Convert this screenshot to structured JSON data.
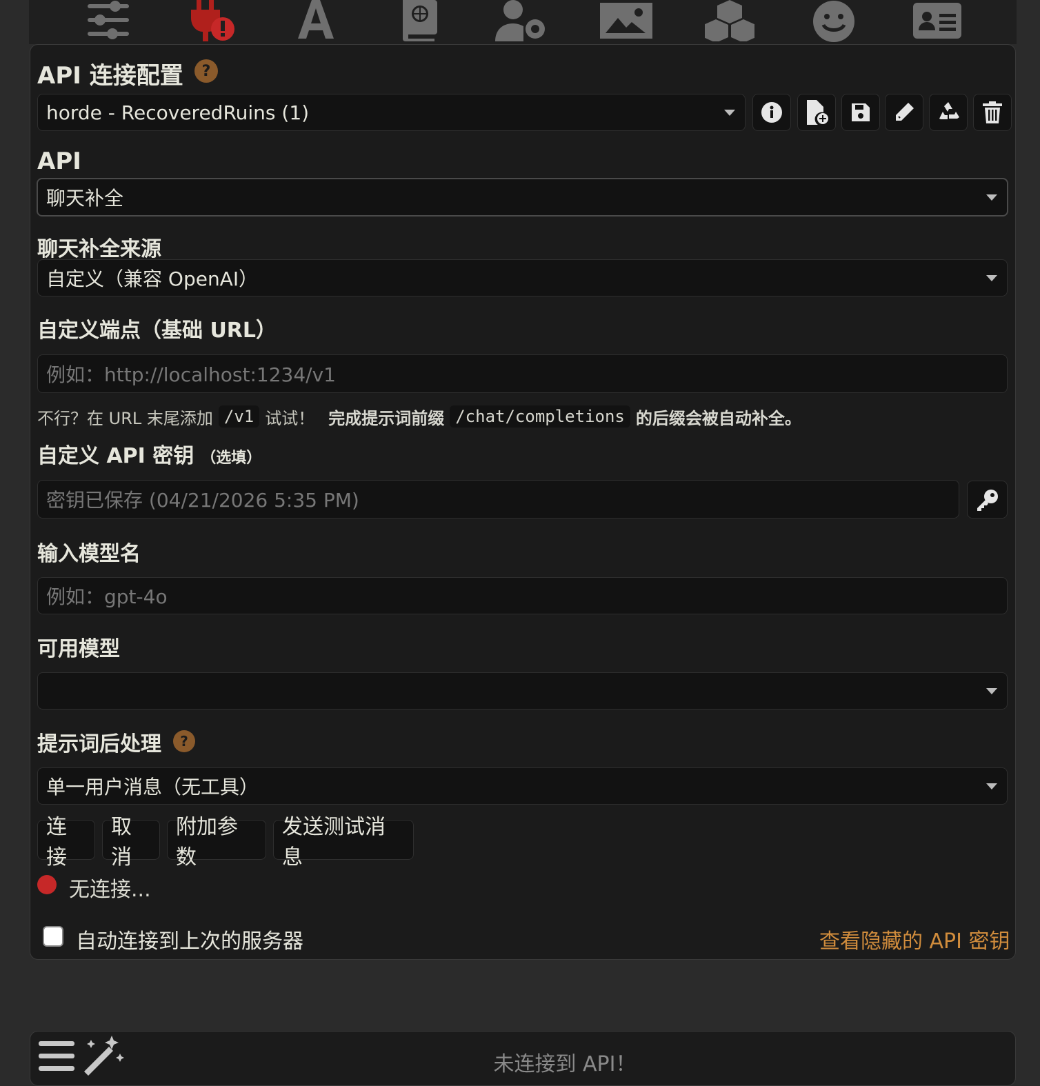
{
  "toolbar": {
    "icons": [
      "sliders-icon",
      "plug-warning-icon",
      "font-a-icon",
      "book-globe-icon",
      "user-gear-icon",
      "image-icon",
      "cubes-icon",
      "smiley-icon",
      "id-card-icon"
    ]
  },
  "connection_profile": {
    "title": "API 连接配置",
    "help": "?",
    "selected": "horde - RecoveredRuins (1)"
  },
  "api": {
    "label": "API",
    "selected": "聊天补全"
  },
  "source": {
    "label": "聊天补全来源",
    "selected": "自定义（兼容 OpenAI）"
  },
  "endpoint": {
    "label": "自定义端点（基础 URL）",
    "placeholder": "例如：http://localhost:1234/v1"
  },
  "hint": {
    "part1": "不行？在 URL 末尾添加",
    "code1": "/v1",
    "part2": "试试！",
    "part3": "完成提示词前缀",
    "code2": "/chat/completions",
    "part4": "的后缀会被自动补全。"
  },
  "api_key": {
    "label": "自定义 API 密钥",
    "optional": "（选填）",
    "placeholder": "密钥已保存 (04/21/2026 5:35 PM)"
  },
  "model_name": {
    "label": "输入模型名",
    "placeholder": "例如：gpt-4o"
  },
  "available_models": {
    "label": "可用模型",
    "selected": ""
  },
  "post_processing": {
    "label": "提示词后处理",
    "help": "?",
    "selected": "单一用户消息（无工具）"
  },
  "buttons": {
    "connect": "连接",
    "cancel": "取消",
    "extra_params": "附加参数",
    "send_test": "发送测试消息"
  },
  "status": {
    "text": "无连接...",
    "color": "#c62828"
  },
  "auto_connect": {
    "label": "自动连接到上次的服务器",
    "checked": false
  },
  "view_hidden_keys": "查看隐藏的 API 密钥",
  "bottom": {
    "placeholder": "未连接到 API！"
  }
}
